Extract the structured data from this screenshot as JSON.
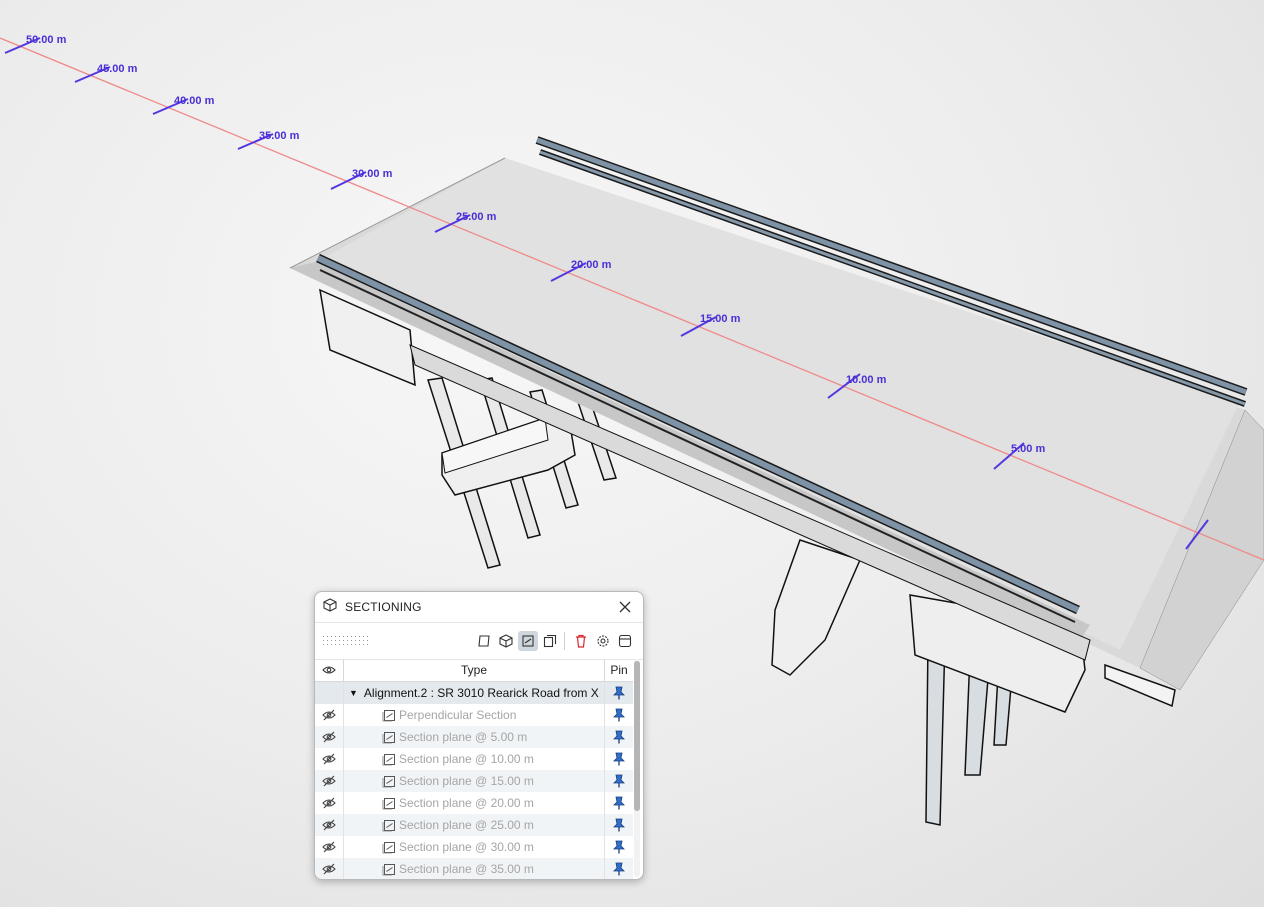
{
  "viewport": {
    "measure_labels": [
      "50.00 m",
      "45.00 m",
      "40.00 m",
      "35.00 m",
      "30.00 m",
      "25.00 m",
      "20.00 m",
      "15.00 m",
      "10.00 m",
      "5.00 m"
    ],
    "colors": {
      "alignment_line": "#f08a8a",
      "measure_ticks": "#5535e0",
      "railing": "#7f93a6"
    }
  },
  "panel": {
    "title": "SECTIONING",
    "toolbar_icons": [
      "plane-icon",
      "box-icon",
      "section-align-icon",
      "copy-planes-icon",
      "trash-icon",
      "gear-icon",
      "panel-icon"
    ],
    "columns": {
      "visibility_icon": "eye-icon",
      "type": "Type",
      "pin": "Pin"
    },
    "parent_row": {
      "label": "Alignment.2 : SR 3010 Rearick Road from X"
    },
    "rows": [
      {
        "label": "Perpendicular Section"
      },
      {
        "label": "Section plane @ 5.00 m"
      },
      {
        "label": "Section plane @ 10.00 m"
      },
      {
        "label": "Section plane @ 15.00 m"
      },
      {
        "label": "Section plane @ 20.00 m"
      },
      {
        "label": "Section plane @ 25.00 m"
      },
      {
        "label": "Section plane @ 30.00 m"
      },
      {
        "label": "Section plane @ 35.00 m"
      }
    ]
  }
}
